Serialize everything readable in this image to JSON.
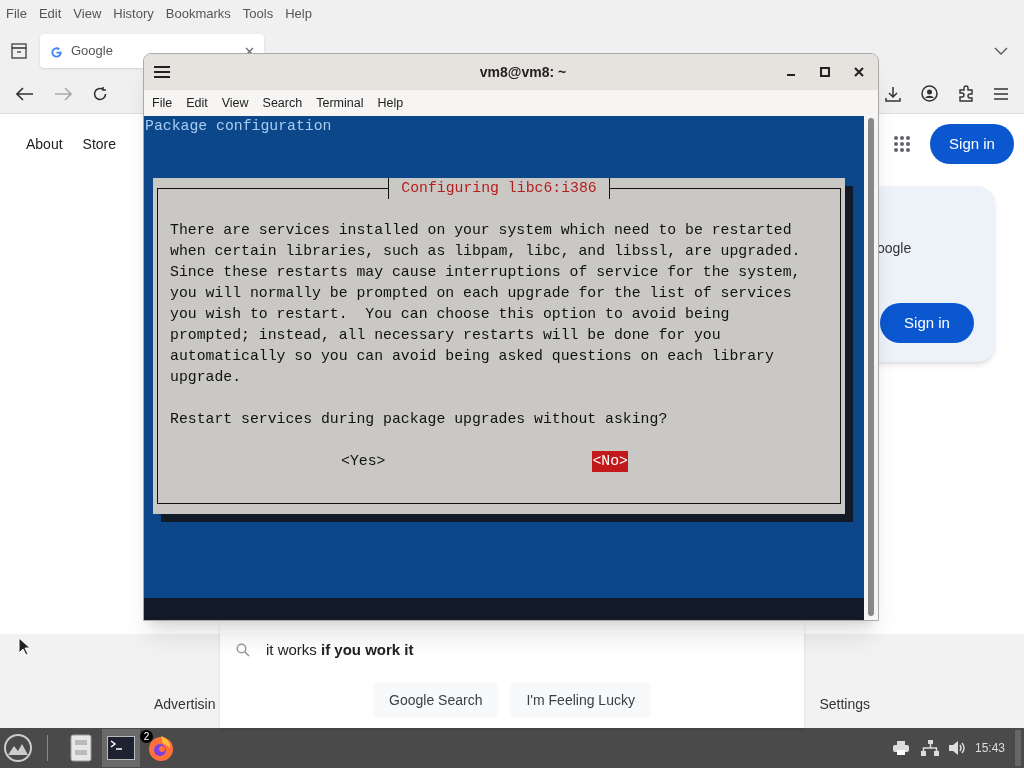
{
  "browser": {
    "menu": [
      "File",
      "Edit",
      "View",
      "History",
      "Bookmarks",
      "Tools",
      "Help"
    ],
    "tabs": [
      {
        "label": "Google",
        "selected": true
      }
    ],
    "page": {
      "nav_links": [
        "About",
        "Store"
      ],
      "sign_in": "Sign in",
      "account_popup": {
        "text": "oogle",
        "button": "Sign in"
      },
      "suggestions": [
        "it works **if you work it**"
      ],
      "buttons": [
        "Google Search",
        "I'm Feeling Lucky"
      ],
      "footer": [
        "Advertisin",
        "Settings"
      ]
    }
  },
  "terminal": {
    "title": "vm8@vm8: ~",
    "menu": [
      "File",
      "Edit",
      "View",
      "Search",
      "Terminal",
      "Help"
    ],
    "header": "Package configuration",
    "dialog": {
      "title": "Configuring libc6:i386",
      "message": [
        "There are services installed on your system which need to be restarted",
        "when certain libraries, such as libpam, libc, and libssl, are upgraded.",
        "Since these restarts may cause interruptions of service for the system,",
        "you will normally be prompted on each upgrade for the list of services",
        "you wish to restart.  You can choose this option to avoid being",
        "prompted; instead, all necessary restarts will be done for you",
        "automatically so you can avoid being asked questions on each library",
        "upgrade."
      ],
      "question": "Restart services during package upgrades without asking?",
      "buttons": [
        {
          "label": "<Yes>",
          "selected": false
        },
        {
          "label": "<No>",
          "selected": true
        }
      ]
    }
  },
  "taskbar": {
    "apps": [
      {
        "kind": "files",
        "active": false
      },
      {
        "kind": "terminal",
        "active": true
      },
      {
        "kind": "firefox",
        "active": false,
        "badge": "2"
      }
    ],
    "clock": "15:43"
  }
}
